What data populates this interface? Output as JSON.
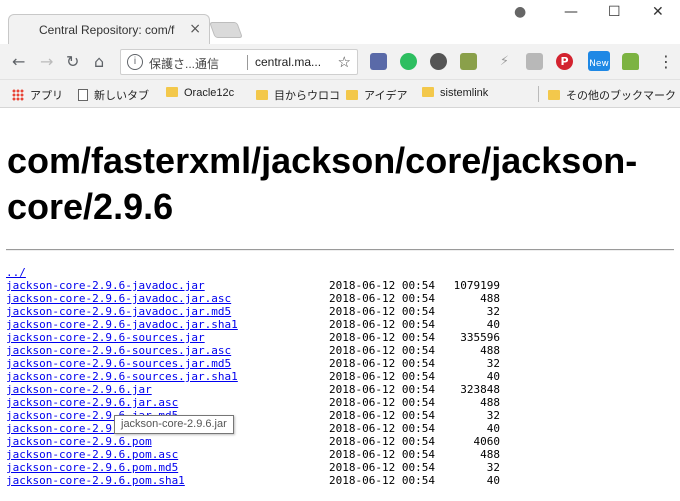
{
  "window": {
    "tab_title": "Central Repository: com/f",
    "tab_close": "×",
    "controls": {
      "account": "●",
      "minimize": "—",
      "maximize": "☐",
      "close": "✕"
    }
  },
  "toolbar": {
    "back": "←",
    "forward": "→",
    "reload": "↻",
    "home": "⌂",
    "security_text": "保護さ...通信",
    "url_text": "central.ma...",
    "star": "☆",
    "menu": "⋮",
    "extensions": [
      {
        "name": "eyedropper-icon",
        "color": "#5a6aa8"
      },
      {
        "name": "evernote-icon",
        "color": "#2dbe60"
      },
      {
        "name": "edge-icon",
        "color": "#555555"
      },
      {
        "name": "note-icon",
        "color": "#8aa04a"
      },
      {
        "name": "bolt-icon",
        "color": "#9e9e9e"
      },
      {
        "name": "rss-icon",
        "color": "#b8b8b8"
      },
      {
        "name": "pinterest-icon",
        "color": "#d3232f"
      },
      {
        "name": "new-badge-icon",
        "color": "#1e88e5",
        "label": "New"
      },
      {
        "name": "android-icon",
        "color": "#7cb342"
      }
    ]
  },
  "bookmarks": {
    "items": [
      {
        "label": "アプリ",
        "type": "apps"
      },
      {
        "label": "新しいタブ",
        "type": "page"
      },
      {
        "label": "Oracle12c",
        "type": "folder"
      },
      {
        "label": "目からウロコ",
        "type": "folder"
      },
      {
        "label": "アイデア",
        "type": "folder"
      },
      {
        "label": "sistemlink",
        "type": "folder"
      }
    ],
    "other": "その他のブックマーク"
  },
  "page": {
    "title": "com/fasterxml/jackson/core/jackson-core/2.9.6",
    "parent_link": "../",
    "files": [
      {
        "name": "jackson-core-2.9.6-javadoc.jar",
        "date": "2018-06-12 00:54",
        "size": "1079199"
      },
      {
        "name": "jackson-core-2.9.6-javadoc.jar.asc",
        "date": "2018-06-12 00:54",
        "size": "488"
      },
      {
        "name": "jackson-core-2.9.6-javadoc.jar.md5",
        "date": "2018-06-12 00:54",
        "size": "32"
      },
      {
        "name": "jackson-core-2.9.6-javadoc.jar.sha1",
        "date": "2018-06-12 00:54",
        "size": "40"
      },
      {
        "name": "jackson-core-2.9.6-sources.jar",
        "date": "2018-06-12 00:54",
        "size": "335596"
      },
      {
        "name": "jackson-core-2.9.6-sources.jar.asc",
        "date": "2018-06-12 00:54",
        "size": "488"
      },
      {
        "name": "jackson-core-2.9.6-sources.jar.md5",
        "date": "2018-06-12 00:54",
        "size": "32"
      },
      {
        "name": "jackson-core-2.9.6-sources.jar.sha1",
        "date": "2018-06-12 00:54",
        "size": "40"
      },
      {
        "name": "jackson-core-2.9.6.jar",
        "date": "2018-06-12 00:54",
        "size": "323848"
      },
      {
        "name": "jackson-core-2.9.6.jar.asc",
        "date": "2018-06-12 00:54",
        "size": "488"
      },
      {
        "name": "jackson-core-2.9.6.jar.md5",
        "date": "2018-06-12 00:54",
        "size": "32"
      },
      {
        "name": "jackson-core-2.9.6.jar.sha1",
        "date": "2018-06-12 00:54",
        "size": "40"
      },
      {
        "name": "jackson-core-2.9.6.pom",
        "date": "2018-06-12 00:54",
        "size": "4060"
      },
      {
        "name": "jackson-core-2.9.6.pom.asc",
        "date": "2018-06-12 00:54",
        "size": "488"
      },
      {
        "name": "jackson-core-2.9.6.pom.md5",
        "date": "2018-06-12 00:54",
        "size": "32"
      },
      {
        "name": "jackson-core-2.9.6.pom.sha1",
        "date": "2018-06-12 00:54",
        "size": "40"
      }
    ],
    "tooltip": "jackson-core-2.9.6.jar"
  }
}
